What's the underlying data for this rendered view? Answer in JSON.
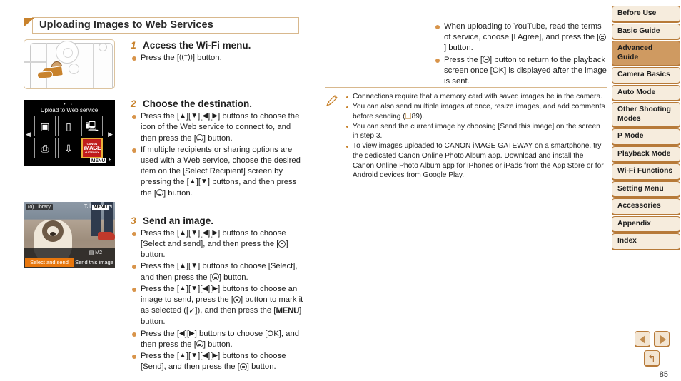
{
  "header": {
    "title": "Uploading Images to Web Services",
    "flag_icon": "corner-flag-icon"
  },
  "figures": {
    "camera": {
      "name": "camera-wifi-button-illustration",
      "menu_label": "MENU"
    },
    "wifi_menu_screen": {
      "title": "Upload to Web service",
      "dots": "• ·",
      "icons": [
        "camera-icon",
        "smartphone-icon",
        "computer-icon",
        "printer-icon",
        "upload-to-computer-icon",
        "canon-image-gateway-icon"
      ],
      "gateway_brand_top": "CANON",
      "gateway_brand_main": "iMAGE",
      "gateway_brand_sub": "GATEWAY",
      "menu_label": "MENU",
      "back_glyph": "↰",
      "arrow_left": "◀",
      "arrow_right": "▶"
    },
    "playback_screen": {
      "library_label": "Library",
      "signal_label": "T.ıl",
      "menu_label": "MENU",
      "back_glyph": "↰",
      "size_label": "M2",
      "resize_icon": "resize-icon",
      "select_and_send": "Select and send",
      "send_this_image": "Send this image"
    }
  },
  "steps": [
    {
      "number": "1",
      "title": "Access the Wi-Fi menu.",
      "bullets": [
        {
          "parts": [
            {
              "t": "text",
              "v": "Press the ["
            },
            {
              "t": "key",
              "v": "((†))"
            },
            {
              "t": "text",
              "v": "] button."
            }
          ]
        }
      ]
    },
    {
      "number": "2",
      "title": "Choose the destination.",
      "bullets": [
        {
          "parts": [
            {
              "t": "text",
              "v": "Press the ["
            },
            {
              "t": "key",
              "v": "▲"
            },
            {
              "t": "text",
              "v": "]["
            },
            {
              "t": "key",
              "v": "▼"
            },
            {
              "t": "text",
              "v": "]["
            },
            {
              "t": "key",
              "v": "◀"
            },
            {
              "t": "text",
              "v": "]["
            },
            {
              "t": "key",
              "v": "▶"
            },
            {
              "t": "text",
              "v": "] buttons to choose the icon of the Web service to connect to, and then press the ["
            },
            {
              "t": "func",
              "v": ""
            },
            {
              "t": "text",
              "v": "] button."
            }
          ]
        },
        {
          "parts": [
            {
              "t": "text",
              "v": "If multiple recipients or sharing options are used with a Web service, choose the desired item on the [Select Recipient] screen by pressing the ["
            },
            {
              "t": "key",
              "v": "▲"
            },
            {
              "t": "text",
              "v": "]["
            },
            {
              "t": "key",
              "v": "▼"
            },
            {
              "t": "text",
              "v": "] buttons, and then press the ["
            },
            {
              "t": "func",
              "v": ""
            },
            {
              "t": "text",
              "v": "] button."
            }
          ]
        }
      ]
    },
    {
      "number": "3",
      "title": "Send an image.",
      "bullets": [
        {
          "parts": [
            {
              "t": "text",
              "v": "Press the ["
            },
            {
              "t": "key",
              "v": "▲"
            },
            {
              "t": "text",
              "v": "]["
            },
            {
              "t": "key",
              "v": "▼"
            },
            {
              "t": "text",
              "v": "]["
            },
            {
              "t": "key",
              "v": "◀"
            },
            {
              "t": "text",
              "v": "]["
            },
            {
              "t": "key",
              "v": "▶"
            },
            {
              "t": "text",
              "v": "] buttons to choose [Select and send], and then press the ["
            },
            {
              "t": "func",
              "v": ""
            },
            {
              "t": "text",
              "v": "] button."
            }
          ]
        },
        {
          "parts": [
            {
              "t": "text",
              "v": "Press the ["
            },
            {
              "t": "key",
              "v": "▲"
            },
            {
              "t": "text",
              "v": "]["
            },
            {
              "t": "key",
              "v": "▼"
            },
            {
              "t": "text",
              "v": "] buttons to choose [Select], and then press the ["
            },
            {
              "t": "func",
              "v": ""
            },
            {
              "t": "text",
              "v": "] button."
            }
          ]
        },
        {
          "parts": [
            {
              "t": "text",
              "v": "Press the ["
            },
            {
              "t": "key",
              "v": "▲"
            },
            {
              "t": "text",
              "v": "]["
            },
            {
              "t": "key",
              "v": "▼"
            },
            {
              "t": "text",
              "v": "]["
            },
            {
              "t": "key",
              "v": "◀"
            },
            {
              "t": "text",
              "v": "]["
            },
            {
              "t": "key",
              "v": "▶"
            },
            {
              "t": "text",
              "v": "] buttons to choose an image to send, press the ["
            },
            {
              "t": "func",
              "v": ""
            },
            {
              "t": "text",
              "v": "] button to mark it as selected (["
            },
            {
              "t": "chk",
              "v": "✓"
            },
            {
              "t": "text",
              "v": "]), and then press the ["
            },
            {
              "t": "menu",
              "v": "MENU"
            },
            {
              "t": "text",
              "v": "] button."
            }
          ]
        },
        {
          "parts": [
            {
              "t": "text",
              "v": "Press the ["
            },
            {
              "t": "key",
              "v": "◀"
            },
            {
              "t": "text",
              "v": "]["
            },
            {
              "t": "key",
              "v": "▶"
            },
            {
              "t": "text",
              "v": "] buttons to choose [OK], and then press the ["
            },
            {
              "t": "func",
              "v": ""
            },
            {
              "t": "text",
              "v": "] button."
            }
          ]
        },
        {
          "parts": [
            {
              "t": "text",
              "v": "Press the ["
            },
            {
              "t": "key",
              "v": "▲"
            },
            {
              "t": "text",
              "v": "]["
            },
            {
              "t": "key",
              "v": "▼"
            },
            {
              "t": "text",
              "v": "]["
            },
            {
              "t": "key",
              "v": "◀"
            },
            {
              "t": "text",
              "v": "]["
            },
            {
              "t": "key",
              "v": "▶"
            },
            {
              "t": "text",
              "v": "] buttons to choose [Send], and then press the ["
            },
            {
              "t": "func",
              "v": ""
            },
            {
              "t": "text",
              "v": "] button."
            }
          ]
        }
      ]
    }
  ],
  "column2_bullets": [
    {
      "parts": [
        {
          "t": "text",
          "v": "When uploading to YouTube, read the terms of service, choose [I Agree], and press the ["
        },
        {
          "t": "func",
          "v": ""
        },
        {
          "t": "text",
          "v": "] button."
        }
      ]
    },
    {
      "parts": [
        {
          "t": "text",
          "v": "Press the ["
        },
        {
          "t": "func",
          "v": ""
        },
        {
          "t": "text",
          "v": "] button to return to the playback screen once [OK] is displayed after the image is sent."
        }
      ]
    }
  ],
  "note": {
    "icon": "pencil-note-icon",
    "items": [
      {
        "parts": [
          {
            "t": "text",
            "v": "Connections require that a memory card with saved images be in the camera."
          }
        ]
      },
      {
        "parts": [
          {
            "t": "text",
            "v": "You can also send multiple images at once, resize images, and add comments before sending ("
          },
          {
            "t": "pageref",
            "v": ""
          },
          {
            "t": "text",
            "v": "89)."
          }
        ]
      },
      {
        "parts": [
          {
            "t": "text",
            "v": "You can send the current image by choosing [Send this image] on the screen in step 3."
          }
        ]
      },
      {
        "parts": [
          {
            "t": "text",
            "v": "To view images uploaded to CANON iMAGE GATEWAY on a smartphone, try the dedicated Canon Online Photo Album app. Download and install the Canon Online Photo Album app for iPhones or iPads from the App Store or for Android devices from Google Play."
          }
        ]
      }
    ]
  },
  "sidebar": {
    "items": [
      {
        "label": "Before Use",
        "state": "normal",
        "level": "top"
      },
      {
        "label": "Basic Guide",
        "state": "normal",
        "level": "top"
      },
      {
        "label": "Advanced Guide",
        "state": "active",
        "level": "top"
      },
      {
        "label": "Camera Basics",
        "state": "normal",
        "level": "sub"
      },
      {
        "label": "Auto Mode",
        "state": "normal",
        "level": "sub"
      },
      {
        "label": "Other Shooting Modes",
        "state": "normal",
        "level": "sub"
      },
      {
        "label": "P Mode",
        "state": "normal",
        "level": "sub"
      },
      {
        "label": "Playback Mode",
        "state": "normal",
        "level": "sub"
      },
      {
        "label": "Wi-Fi Functions",
        "state": "active",
        "level": "sub"
      },
      {
        "label": "Setting Menu",
        "state": "normal",
        "level": "sub"
      },
      {
        "label": "Accessories",
        "state": "normal",
        "level": "sub"
      },
      {
        "label": "Appendix",
        "state": "normal",
        "level": "sub"
      },
      {
        "label": "Index",
        "state": "normal",
        "level": "top"
      }
    ]
  },
  "footer": {
    "prev_icon": "previous-page-icon",
    "next_icon": "next-page-icon",
    "home_icon": "return-home-icon",
    "home_glyph": "↰",
    "page_number": "85"
  },
  "colors": {
    "accent_brown": "#c8822c",
    "sidebar_border": "#b77a39",
    "sidebar_fill": "#f3e5d2",
    "sidebar_active": "#cf9a61",
    "header_border": "#d8b88d",
    "selection_orange": "#e8770d"
  }
}
